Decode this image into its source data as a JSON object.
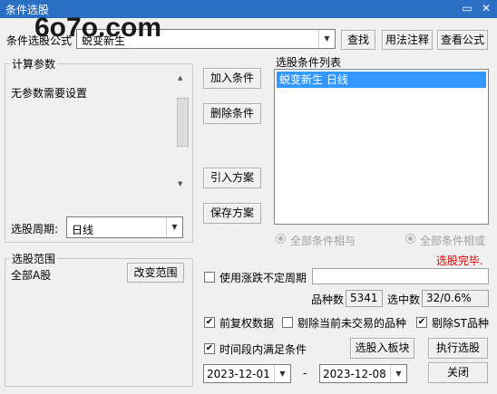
{
  "window": {
    "title": "条件选股",
    "minimize_glyph": "▭",
    "close_glyph": "✕"
  },
  "watermark": "6o7o.com",
  "condition_select": {
    "label": "条件选股公式",
    "value": "蜕变新生"
  },
  "top_buttons": {
    "find": "查找",
    "usage": "用法注释",
    "view_formula": "查看公式"
  },
  "calc_params": {
    "title": "计算参数",
    "message": "无参数需要设置"
  },
  "period": {
    "label": "选股周期:",
    "value": "日线"
  },
  "scope": {
    "title": "选股范围",
    "value": "全部A股",
    "change_button": "改变范围"
  },
  "middle_buttons": {
    "add": "加入条件",
    "delete": "删除条件",
    "import": "引入方案",
    "save": "保存方案"
  },
  "condition_list": {
    "title": "选股条件列表",
    "items": [
      "蜕变新生  日线"
    ]
  },
  "logic": {
    "and_label": "全部条件相与",
    "or_label": "全部条件相或"
  },
  "status": {
    "text": "选股完毕.",
    "color": "#e00000"
  },
  "options": {
    "use_variable_period": {
      "label": "使用涨跌不定周期",
      "checked": false
    },
    "forward_adjust": {
      "label": "前复权数据",
      "checked": true
    },
    "exclude_untraded": {
      "label": "剔除当前未交易的品种",
      "checked": false
    },
    "exclude_st": {
      "label": "剔除ST品种",
      "checked": true
    },
    "period_satisfy": {
      "label": "时间段内满足条件",
      "checked": true
    }
  },
  "stats": {
    "count_label": "品种数",
    "count_value": "5341",
    "selected_label": "选中数",
    "selected_value": "32/0.6%"
  },
  "date_range": {
    "start": "2023-12-01",
    "separator": "-",
    "end": "2023-12-08"
  },
  "bottom_buttons": {
    "to_block": "选股入板块",
    "execute": "执行选股",
    "close": "关闭"
  },
  "colors": {
    "titlebar": "#2a6fc4",
    "selection": "#3399ff"
  }
}
